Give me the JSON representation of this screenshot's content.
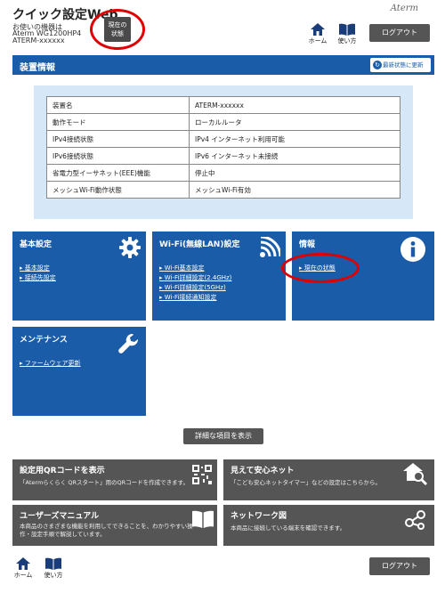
{
  "header": {
    "title": "クイック設定Web",
    "model_label": "お使いの機器は",
    "model_name": "Aterm WG1200HP4",
    "device_id": "ATERM-xxxxxx",
    "status_button": [
      "現在の",
      "状態"
    ],
    "brand": "Aterm",
    "nav": {
      "home": "ホーム",
      "help": "使い方"
    },
    "logout": "ログアウト"
  },
  "device_info": {
    "title": "装置情報",
    "refresh": "最新状態に更新",
    "rows": [
      [
        "装置名",
        "ATERM-xxxxxx"
      ],
      [
        "動作モード",
        "ローカルルータ"
      ],
      [
        "IPv4接続状態",
        "IPv4 インターネット利用可能"
      ],
      [
        "IPv6接続状態",
        "IPv6 インターネット未接続"
      ],
      [
        "省電力型イーサネット(EEE)機能",
        "停止中"
      ],
      [
        "メッシュWi-Fi動作状態",
        "メッシュWi-Fi有効"
      ]
    ]
  },
  "tiles": {
    "basic": {
      "title": "基本設定",
      "links": [
        "基本設定",
        "接続先設定"
      ]
    },
    "wifi": {
      "title": "Wi-Fi(無線LAN)設定",
      "links": [
        "Wi-Fi基本設定",
        "Wi-Fi詳細設定(2.4GHz)",
        "Wi-Fi詳細設定(5GHz)",
        "Wi-Fi接続通知設定"
      ]
    },
    "info": {
      "title": "情報",
      "links": [
        "現在の状態"
      ]
    },
    "maintenance": {
      "title": "メンテナンス",
      "links": [
        "ファームウェア更新"
      ]
    }
  },
  "detail_button": "詳細な項目を表示",
  "gray_tiles": {
    "qr": {
      "title": "設定用QRコードを表示",
      "desc": "「Atermらくらく QRスタート」用のQRコードを作成できます。"
    },
    "safety": {
      "title": "見えて安心ネット",
      "desc": "「こども安心ネットタイマー」などの設定はこちらから。"
    },
    "manual": {
      "title": "ユーザーズマニュアル",
      "desc1": "本商品のさまざまな機能を利用してできることを、わかりやすい操",
      "desc2": "作・設定手順で解説しています。"
    },
    "network": {
      "title": "ネットワーク図",
      "desc": "本商品に接続している端末を確認できます。"
    }
  },
  "footer": {
    "home": "ホーム",
    "help": "使い方",
    "logout": "ログアウト"
  },
  "colors": {
    "primary": "#1a5ca8",
    "info_bg": "#d6e8f8",
    "button_gray": "#555555",
    "highlight": "#e00000"
  }
}
